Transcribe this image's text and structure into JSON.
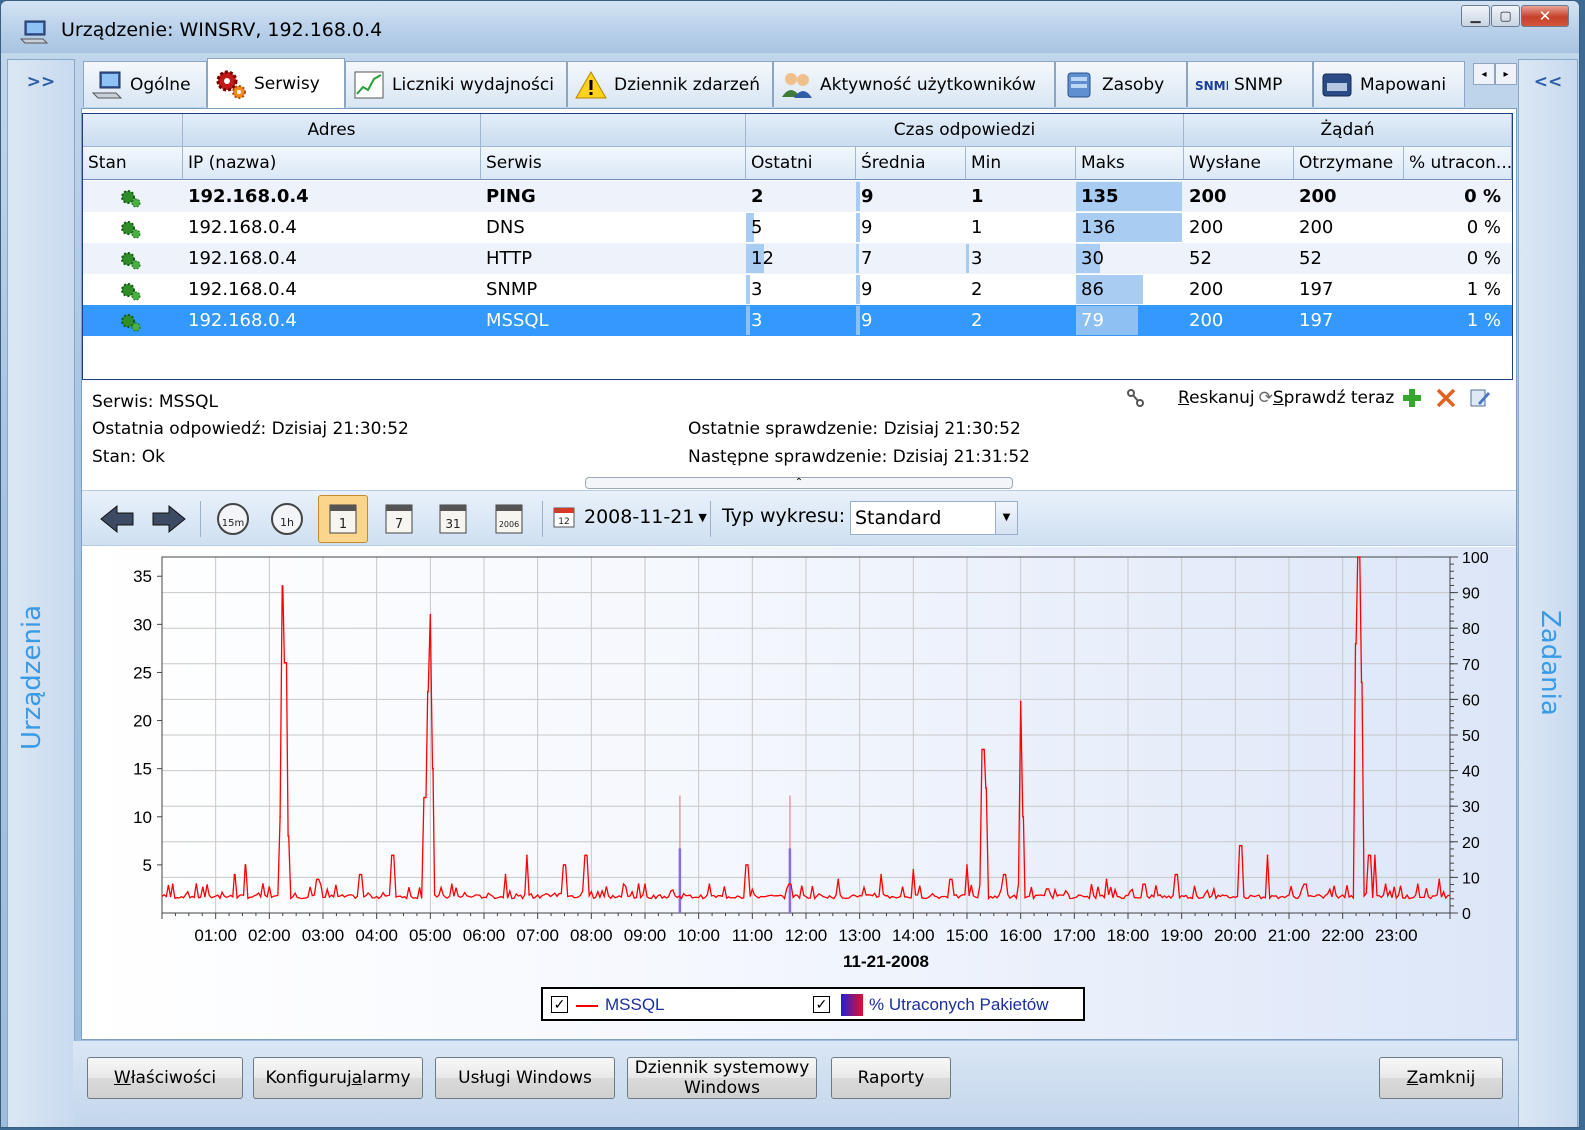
{
  "window": {
    "title": "Urządzenie:  WINSRV, 192.168.0.4"
  },
  "side": {
    "left_arrows": ">>",
    "left_label": "Urządzenia",
    "right_arrows": "<<",
    "right_label": "Zadania"
  },
  "tabs": [
    {
      "label": "Ogólne",
      "icon": "computer-icon"
    },
    {
      "label": "Serwisy",
      "icon": "gears-icon",
      "active": true
    },
    {
      "label": "Liczniki wydajności",
      "icon": "chart-icon"
    },
    {
      "label": "Dziennik zdarzeń",
      "icon": "warning-icon"
    },
    {
      "label": "Aktywność użytkowników",
      "icon": "users-icon"
    },
    {
      "label": "Zasoby",
      "icon": "resources-icon"
    },
    {
      "label": "SNMP",
      "icon": "snmp-icon"
    },
    {
      "label": "Mapowani",
      "icon": "map-icon"
    }
  ],
  "grid": {
    "group_headers": {
      "adres": "Adres",
      "czas": "Czas odpowiedzi",
      "zadan": "Żądań"
    },
    "columns": [
      "Stan",
      "IP (nazwa)",
      "Serwis",
      "Ostatni",
      "Średnia",
      "Min",
      "Maks",
      "Wysłane",
      "Otrzymane",
      "% utracon..."
    ],
    "rows": [
      {
        "ip": "192.168.0.4",
        "service": "PING",
        "last": "2",
        "avg": "9",
        "min": "1",
        "max": "135",
        "sent": "200",
        "recv": "200",
        "lost": "0 %",
        "bold": true
      },
      {
        "ip": "192.168.0.4",
        "service": "DNS",
        "last": "5",
        "avg": "9",
        "min": "1",
        "max": "136",
        "sent": "200",
        "recv": "200",
        "lost": "0 %"
      },
      {
        "ip": "192.168.0.4",
        "service": "HTTP",
        "last": "12",
        "avg": "7",
        "min": "3",
        "max": "30",
        "sent": "52",
        "recv": "52",
        "lost": "0 %"
      },
      {
        "ip": "192.168.0.4",
        "service": "SNMP",
        "last": "3",
        "avg": "9",
        "min": "2",
        "max": "86",
        "sent": "200",
        "recv": "197",
        "lost": "1 %"
      },
      {
        "ip": "192.168.0.4",
        "service": "MSSQL",
        "last": "3",
        "avg": "9",
        "min": "2",
        "max": "79",
        "sent": "200",
        "recv": "197",
        "lost": "1 %",
        "selected": true
      }
    ]
  },
  "details": {
    "service": "Serwis: MSSQL",
    "last_response": "Ostatnia odpowiedź: Dzisiaj 21:30:52",
    "status": "Stan: Ok",
    "last_check": "Ostatnie sprawdzenie: Dzisiaj 21:30:52",
    "next_check": "Następne sprawdzenie: Dzisiaj 21:31:52"
  },
  "actions": {
    "rescan": "Reskanuj",
    "check_now": "Sprawdź teraz"
  },
  "chart_toolbar": {
    "date": "2008-11-21",
    "chart_type_label": "Typ wykresu:",
    "chart_type_value": "Standard",
    "icons": [
      "back-arrow-icon",
      "forward-arrow-icon",
      "clock-15m-icon",
      "clock-1h-icon",
      "calendar-1-icon",
      "calendar-7-icon",
      "calendar-31-icon",
      "calendar-2006-icon"
    ],
    "clock_labels": [
      "15m",
      "1h"
    ],
    "calendar_labels": [
      "1",
      "7",
      "31",
      "2006"
    ],
    "date_icon_label": "12"
  },
  "chart_data": {
    "type": "line",
    "xlabel": "11-21-2008",
    "x_ticks": [
      "01:00",
      "02:00",
      "03:00",
      "04:00",
      "05:00",
      "06:00",
      "07:00",
      "08:00",
      "09:00",
      "10:00",
      "11:00",
      "12:00",
      "13:00",
      "14:00",
      "15:00",
      "16:00",
      "17:00",
      "18:00",
      "19:00",
      "20:00",
      "21:00",
      "22:00",
      "23:00"
    ],
    "y_left_ticks": [
      5,
      10,
      15,
      20,
      25,
      30,
      35
    ],
    "y_left_lim": [
      0,
      37
    ],
    "y_right_ticks": [
      0,
      10,
      20,
      30,
      40,
      50,
      60,
      70,
      80,
      90,
      100
    ],
    "y_right_lim": [
      0,
      100
    ],
    "grid": true,
    "legend_position": "bottom",
    "series": [
      {
        "name": "MSSQL",
        "axis": "left",
        "color": "#ff0000",
        "baseline": 1.5,
        "peaks": [
          {
            "x": 0.2,
            "y": 3
          },
          {
            "x": 1.35,
            "y": 4
          },
          {
            "x": 1.55,
            "y": 5
          },
          {
            "x": 2.2,
            "y": 10
          },
          {
            "x": 2.25,
            "y": 34
          },
          {
            "x": 2.3,
            "y": 26
          },
          {
            "x": 2.35,
            "y": 8
          },
          {
            "x": 2.9,
            "y": 3.5
          },
          {
            "x": 3.7,
            "y": 4
          },
          {
            "x": 4.3,
            "y": 6
          },
          {
            "x": 4.9,
            "y": 12
          },
          {
            "x": 4.95,
            "y": 23
          },
          {
            "x": 5.0,
            "y": 31
          },
          {
            "x": 5.05,
            "y": 15
          },
          {
            "x": 5.4,
            "y": 3
          },
          {
            "x": 6.4,
            "y": 4
          },
          {
            "x": 6.8,
            "y": 6
          },
          {
            "x": 7.5,
            "y": 5
          },
          {
            "x": 7.9,
            "y": 6
          },
          {
            "x": 8.6,
            "y": 3
          },
          {
            "x": 9.0,
            "y": 3
          },
          {
            "x": 10.2,
            "y": 3
          },
          {
            "x": 10.9,
            "y": 5
          },
          {
            "x": 11.7,
            "y": 3
          },
          {
            "x": 12.6,
            "y": 3.5
          },
          {
            "x": 13.4,
            "y": 4
          },
          {
            "x": 14.0,
            "y": 4.5
          },
          {
            "x": 14.7,
            "y": 3.5
          },
          {
            "x": 15.0,
            "y": 5
          },
          {
            "x": 15.3,
            "y": 17
          },
          {
            "x": 15.35,
            "y": 13
          },
          {
            "x": 15.7,
            "y": 4
          },
          {
            "x": 16.0,
            "y": 22
          },
          {
            "x": 16.05,
            "y": 10
          },
          {
            "x": 16.5,
            "y": 2.5
          },
          {
            "x": 17.6,
            "y": 3.5
          },
          {
            "x": 18.3,
            "y": 3
          },
          {
            "x": 18.9,
            "y": 4
          },
          {
            "x": 19.6,
            "y": 2.5
          },
          {
            "x": 20.1,
            "y": 7
          },
          {
            "x": 20.6,
            "y": 6
          },
          {
            "x": 21.3,
            "y": 3
          },
          {
            "x": 22.25,
            "y": 28
          },
          {
            "x": 22.3,
            "y": 37
          },
          {
            "x": 22.35,
            "y": 24
          },
          {
            "x": 22.5,
            "y": 6
          },
          {
            "x": 22.6,
            "y": 6
          },
          {
            "x": 22.8,
            "y": 3
          },
          {
            "x": 23.4,
            "y": 3
          },
          {
            "x": 23.8,
            "y": 3.5
          }
        ]
      },
      {
        "name": "% Utraconych Pakietów",
        "axis": "right",
        "color": "#8a6be0",
        "points": [
          {
            "x": 9.65,
            "y": 33
          },
          {
            "x": 11.7,
            "y": 33
          }
        ]
      }
    ]
  },
  "legend": {
    "series1": "MSSQL",
    "series2": "% Utraconych Pakietów"
  },
  "buttons": {
    "properties": "Właściwości",
    "alarms_prefix": "Konfiguruj ",
    "alarms_underlined": "a",
    "alarms_suffix": "larmy",
    "windows_services": "Usługi Windows",
    "syslog_line1": "Dziennik systemowy",
    "syslog_line2": "Windows",
    "reports": "Raporty",
    "close": "Zamknij"
  }
}
